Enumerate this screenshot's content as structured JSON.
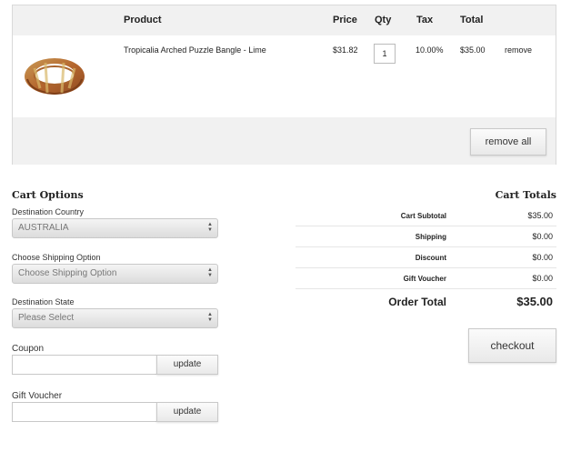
{
  "cart": {
    "headers": {
      "product": "Product",
      "price": "Price",
      "qty": "Qty",
      "tax": "Tax",
      "total": "Total"
    },
    "items": [
      {
        "name": "Tropicalia Arched Puzzle Bangle - Lime",
        "price": "$31.82",
        "qty": "1",
        "tax": "10.00%",
        "total": "$35.00",
        "remove": "remove"
      }
    ],
    "remove_all": "remove all"
  },
  "cart_options": {
    "title": "Cart Options",
    "country_label": "Destination Country",
    "country_value": "AUSTRALIA",
    "shipping_label": "Choose Shipping Option",
    "shipping_value": "Choose Shipping Option",
    "state_label": "Destination State",
    "state_value": "Please Select",
    "coupon_label": "Coupon",
    "coupon_button": "update",
    "voucher_label": "Gift Voucher",
    "voucher_button": "update"
  },
  "cart_totals": {
    "title": "Cart Totals",
    "subtotal_label": "Cart Subtotal",
    "subtotal_value": "$35.00",
    "shipping_label": "Shipping",
    "shipping_value": "$0.00",
    "discount_label": "Discount",
    "discount_value": "$0.00",
    "voucher_label": "Gift Voucher",
    "voucher_value": "$0.00",
    "order_total_label": "Order Total",
    "order_total_value": "$35.00",
    "checkout": "checkout"
  }
}
